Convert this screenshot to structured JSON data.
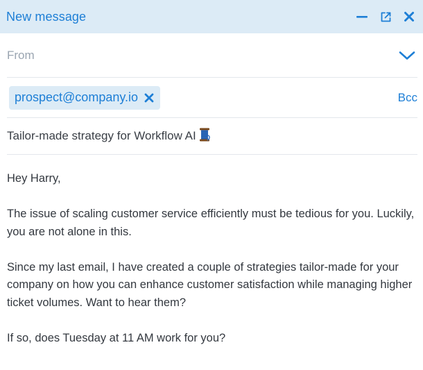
{
  "header": {
    "title": "New message",
    "minimize_icon": "minimize-icon",
    "popout_icon": "popout-icon",
    "close_icon": "close-icon"
  },
  "from": {
    "label": "From",
    "dropdown_icon": "chevron-down-icon"
  },
  "to": {
    "recipients": [
      "prospect@company.io"
    ],
    "remove_icon": "close-icon",
    "bcc_label": "Bcc"
  },
  "subject": {
    "text": "Tailor-made strategy for Workflow AI",
    "emoji_icon": "thread-spool-icon"
  },
  "body": {
    "paragraphs": [
      "Hey Harry,",
      "The issue of scaling customer service efficiently must be tedious for you. Luckily, you are not alone in this.",
      "Since my last email, I have created a couple of strategies tailor-made for your company on how you can enhance customer satisfaction while managing higher ticket volumes. Want to hear them?",
      "If so, does Tuesday at 11 AM work for you?"
    ]
  },
  "colors": {
    "accent": "#1e7fd6",
    "header_bg": "#dcebf6",
    "muted": "#9aa5b1",
    "divider": "#e3e7ec"
  }
}
